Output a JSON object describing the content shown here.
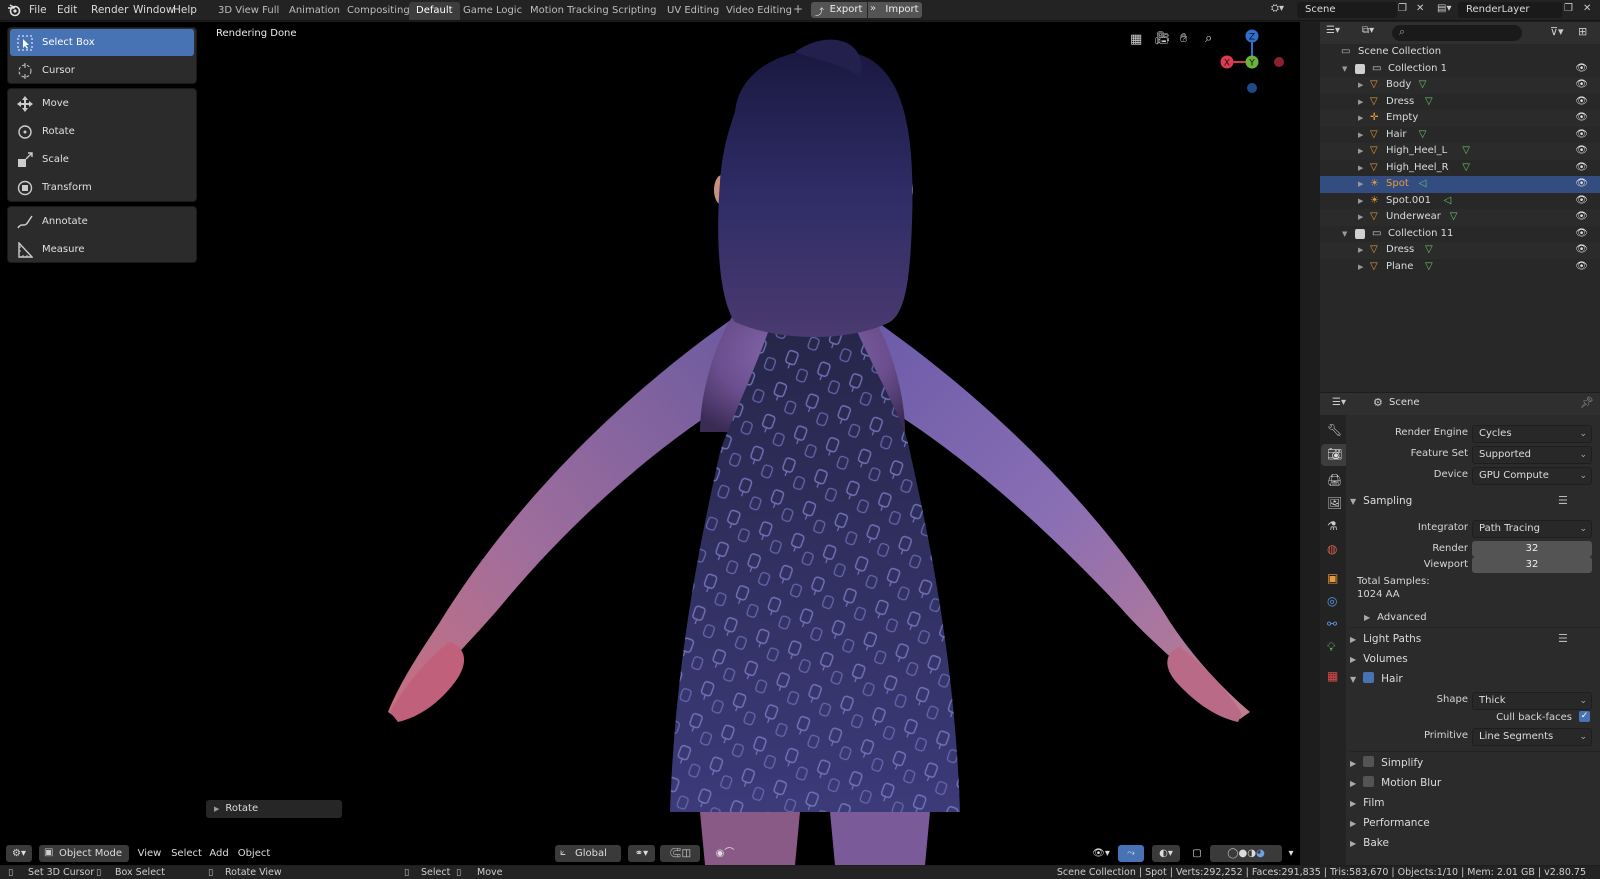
{
  "menu": [
    "File",
    "Edit",
    "Render",
    "Window",
    "Help"
  ],
  "workspaces": [
    "3D View Full",
    "Animation",
    "Compositing",
    "Default",
    "Game Logic",
    "Motion Tracking",
    "Scripting",
    "UV Editing",
    "Video Editing"
  ],
  "active_workspace": "Default",
  "add_workspace": "+",
  "export_label": "Export",
  "import_label": "Import",
  "scene_name": "Scene",
  "view_layer": "RenderLayer",
  "viewport": {
    "status_text": "Rendering Done",
    "gizmo_axes": {
      "x": "X",
      "y": "Y",
      "z": "Z"
    },
    "operator_panel_label": "Rotate"
  },
  "tools": [
    {
      "label": "Select Box",
      "icon": "select-box-icon",
      "active": true
    },
    {
      "label": "Cursor",
      "icon": "cursor-icon"
    },
    {
      "label": "Move",
      "icon": "move-icon"
    },
    {
      "label": "Rotate",
      "icon": "rotate-icon"
    },
    {
      "label": "Scale",
      "icon": "scale-icon"
    },
    {
      "label": "Transform",
      "icon": "transform-icon"
    },
    {
      "label": "Annotate",
      "icon": "annotate-icon"
    },
    {
      "label": "Measure",
      "icon": "measure-icon"
    }
  ],
  "viewport_header": {
    "mode": "Object Mode",
    "menus": [
      "View",
      "Select",
      "Add",
      "Object"
    ],
    "orientation": "Global"
  },
  "outliner": {
    "root": "Scene Collection",
    "items": [
      {
        "label": "Collection 1",
        "type": "collection"
      },
      {
        "label": "Body",
        "type": "mesh"
      },
      {
        "label": "Dress",
        "type": "mesh"
      },
      {
        "label": "Empty",
        "type": "empty"
      },
      {
        "label": "Hair",
        "type": "mesh"
      },
      {
        "label": "High_Heel_L",
        "type": "mesh"
      },
      {
        "label": "High_Heel_R",
        "type": "mesh"
      },
      {
        "label": "Spot",
        "type": "light",
        "selected": true
      },
      {
        "label": "Spot.001",
        "type": "light"
      },
      {
        "label": "Underwear",
        "type": "mesh"
      },
      {
        "label": "Collection 11",
        "type": "collection"
      },
      {
        "label": "Dress",
        "type": "mesh"
      },
      {
        "label": "Plane",
        "type": "mesh"
      }
    ]
  },
  "properties": {
    "context": "Scene",
    "render_engine_label": "Render Engine",
    "render_engine": "Cycles",
    "feature_set_label": "Feature Set",
    "feature_set": "Supported",
    "device_label": "Device",
    "device": "GPU Compute",
    "sampling": "Sampling",
    "integrator_label": "Integrator",
    "integrator": "Path Tracing",
    "render_label": "Render",
    "render_samples": "32",
    "viewport_label": "Viewport",
    "viewport_samples": "32",
    "total_samples_label": "Total Samples:",
    "total_samples": "1024 AA",
    "advanced": "Advanced",
    "light_paths": "Light Paths",
    "volumes": "Volumes",
    "hair": "Hair",
    "shape_label": "Shape",
    "shape": "Thick",
    "cull_label": "Cull back-faces",
    "primitive_label": "Primitive",
    "primitive": "Line Segments",
    "simplify": "Simplify",
    "motion_blur": "Motion Blur",
    "film": "Film",
    "performance": "Performance",
    "bake": "Bake"
  },
  "statusbar": {
    "left": [
      "Set 3D Cursor",
      "Box Select",
      "Rotate View",
      "Select",
      "Move"
    ],
    "right": "Scene Collection | Spot | Verts:292,252 | Faces:291,835 | Tris:583,670 | Objects:1/10 | Mem: 2.01 GB | v2.80.75"
  }
}
